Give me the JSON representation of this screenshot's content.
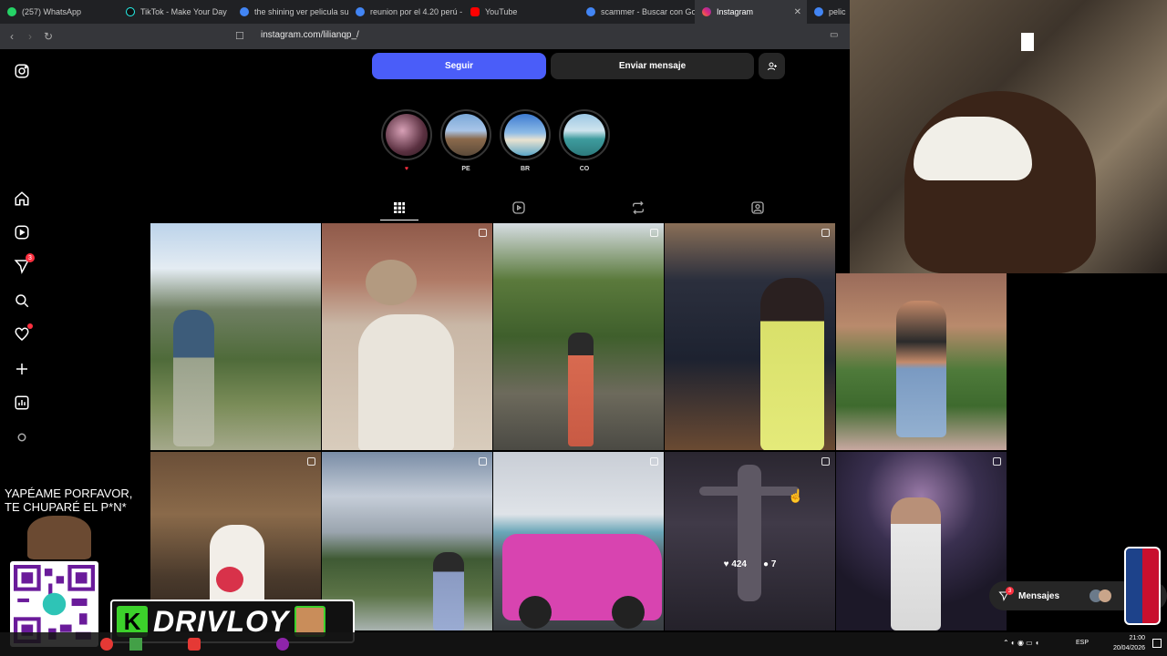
{
  "browser": {
    "tabs": [
      {
        "label": "(257) WhatsApp",
        "color": "#25d366"
      },
      {
        "label": "TikTok - Make Your Day",
        "color": "#111111"
      },
      {
        "label": "the shining ver pelicula sub",
        "color": "#4285f4"
      },
      {
        "label": "reunion por el 4.20 perú -",
        "color": "#4285f4"
      },
      {
        "label": "YouTube",
        "color": "#ff0000"
      },
      {
        "label": "scammer - Buscar con Goo",
        "color": "#4285f4"
      },
      {
        "label": "Instagram",
        "color": "#e1306c"
      },
      {
        "label": "pelic",
        "color": "#4285f4"
      }
    ],
    "url": "instagram.com/lilianqp_/"
  },
  "sidebar": {
    "icons": [
      "instagram-icon",
      "home-icon",
      "reels-icon",
      "messages-icon",
      "search-icon",
      "notifications-icon",
      "create-icon",
      "dashboard-icon",
      "threads-icon"
    ],
    "messages_badge": "3"
  },
  "profile": {
    "follow_label": "Seguir",
    "message_label": "Enviar mensaje"
  },
  "highlights": [
    {
      "label": "♥"
    },
    {
      "label": "PE"
    },
    {
      "label": "BR"
    },
    {
      "label": "CO"
    }
  ],
  "grid": {
    "hover_likes": "424",
    "hover_comments": "7"
  },
  "overlay": {
    "yape_line1": "YAPÉAME PORFAVOR,",
    "yape_line2": "TE CHUPARÉ  EL P*N*",
    "brand": "DRIVLOY"
  },
  "messages": {
    "label": "Mensajes",
    "badge": "3"
  },
  "taskbar": {
    "lang": "ESP",
    "time": "21:00",
    "date": "20/04/2026"
  }
}
